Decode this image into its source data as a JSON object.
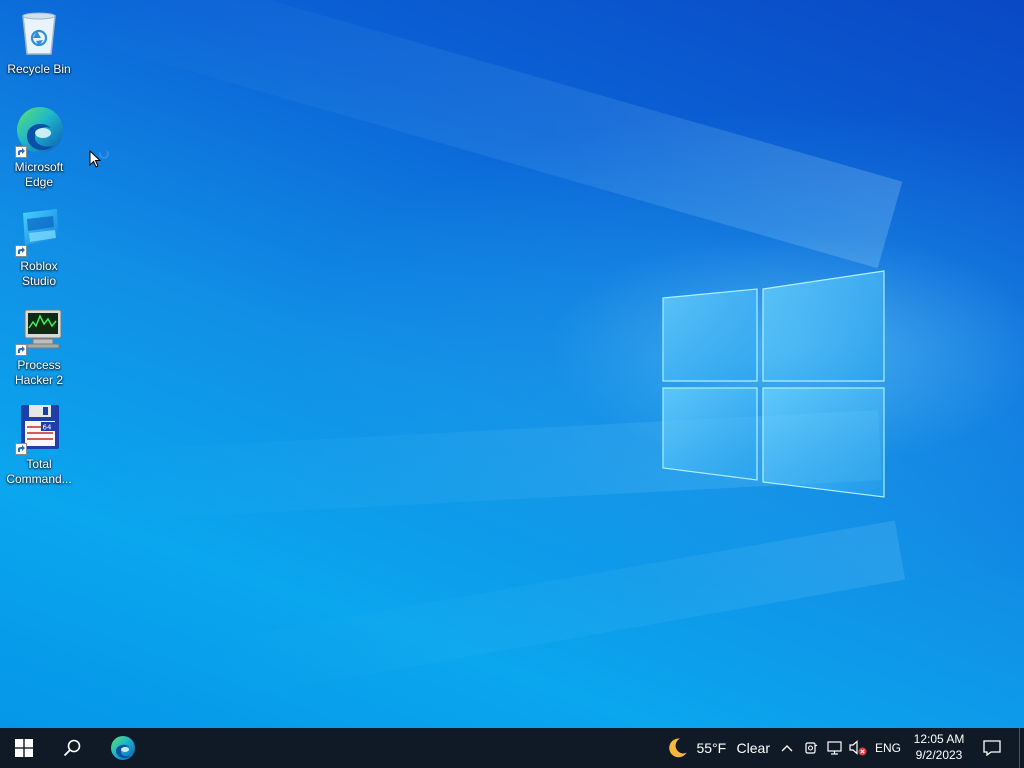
{
  "desktop": {
    "icons": [
      {
        "label": "Recycle Bin",
        "icon": "recycle-bin-icon"
      },
      {
        "label": "Microsoft Edge",
        "icon": "edge-icon",
        "shortcut": true
      },
      {
        "label": "Roblox Studio",
        "icon": "roblox-studio-icon",
        "shortcut": true
      },
      {
        "label": "Process Hacker 2",
        "icon": "process-hacker-icon",
        "shortcut": true
      },
      {
        "label": "Total Command...",
        "icon": "total-commander-icon",
        "shortcut": true
      }
    ]
  },
  "taskbar": {
    "start_icon": "windows-start-icon",
    "search_icon": "search-icon",
    "pinned": [
      {
        "name": "Microsoft Edge",
        "icon": "edge-icon"
      }
    ],
    "weather": {
      "icon": "moon-icon",
      "temperature": "55°F",
      "condition": "Clear"
    },
    "tray": {
      "overflow_icon": "chevron-up-icon",
      "meet_icon": "meet-now-icon",
      "network_icon": "network-icon",
      "volume_icon": "volume-muted-icon",
      "language": "ENG"
    },
    "clock": {
      "time": "12:05 AM",
      "date": "9/2/2023"
    },
    "notification_icon": "action-center-icon"
  },
  "colors": {
    "wallpaper_deep": "#0a48c4",
    "wallpaper_light": "#0aa6ee",
    "taskbar": "#101a27",
    "logo_glass": "#7fd8ff"
  }
}
